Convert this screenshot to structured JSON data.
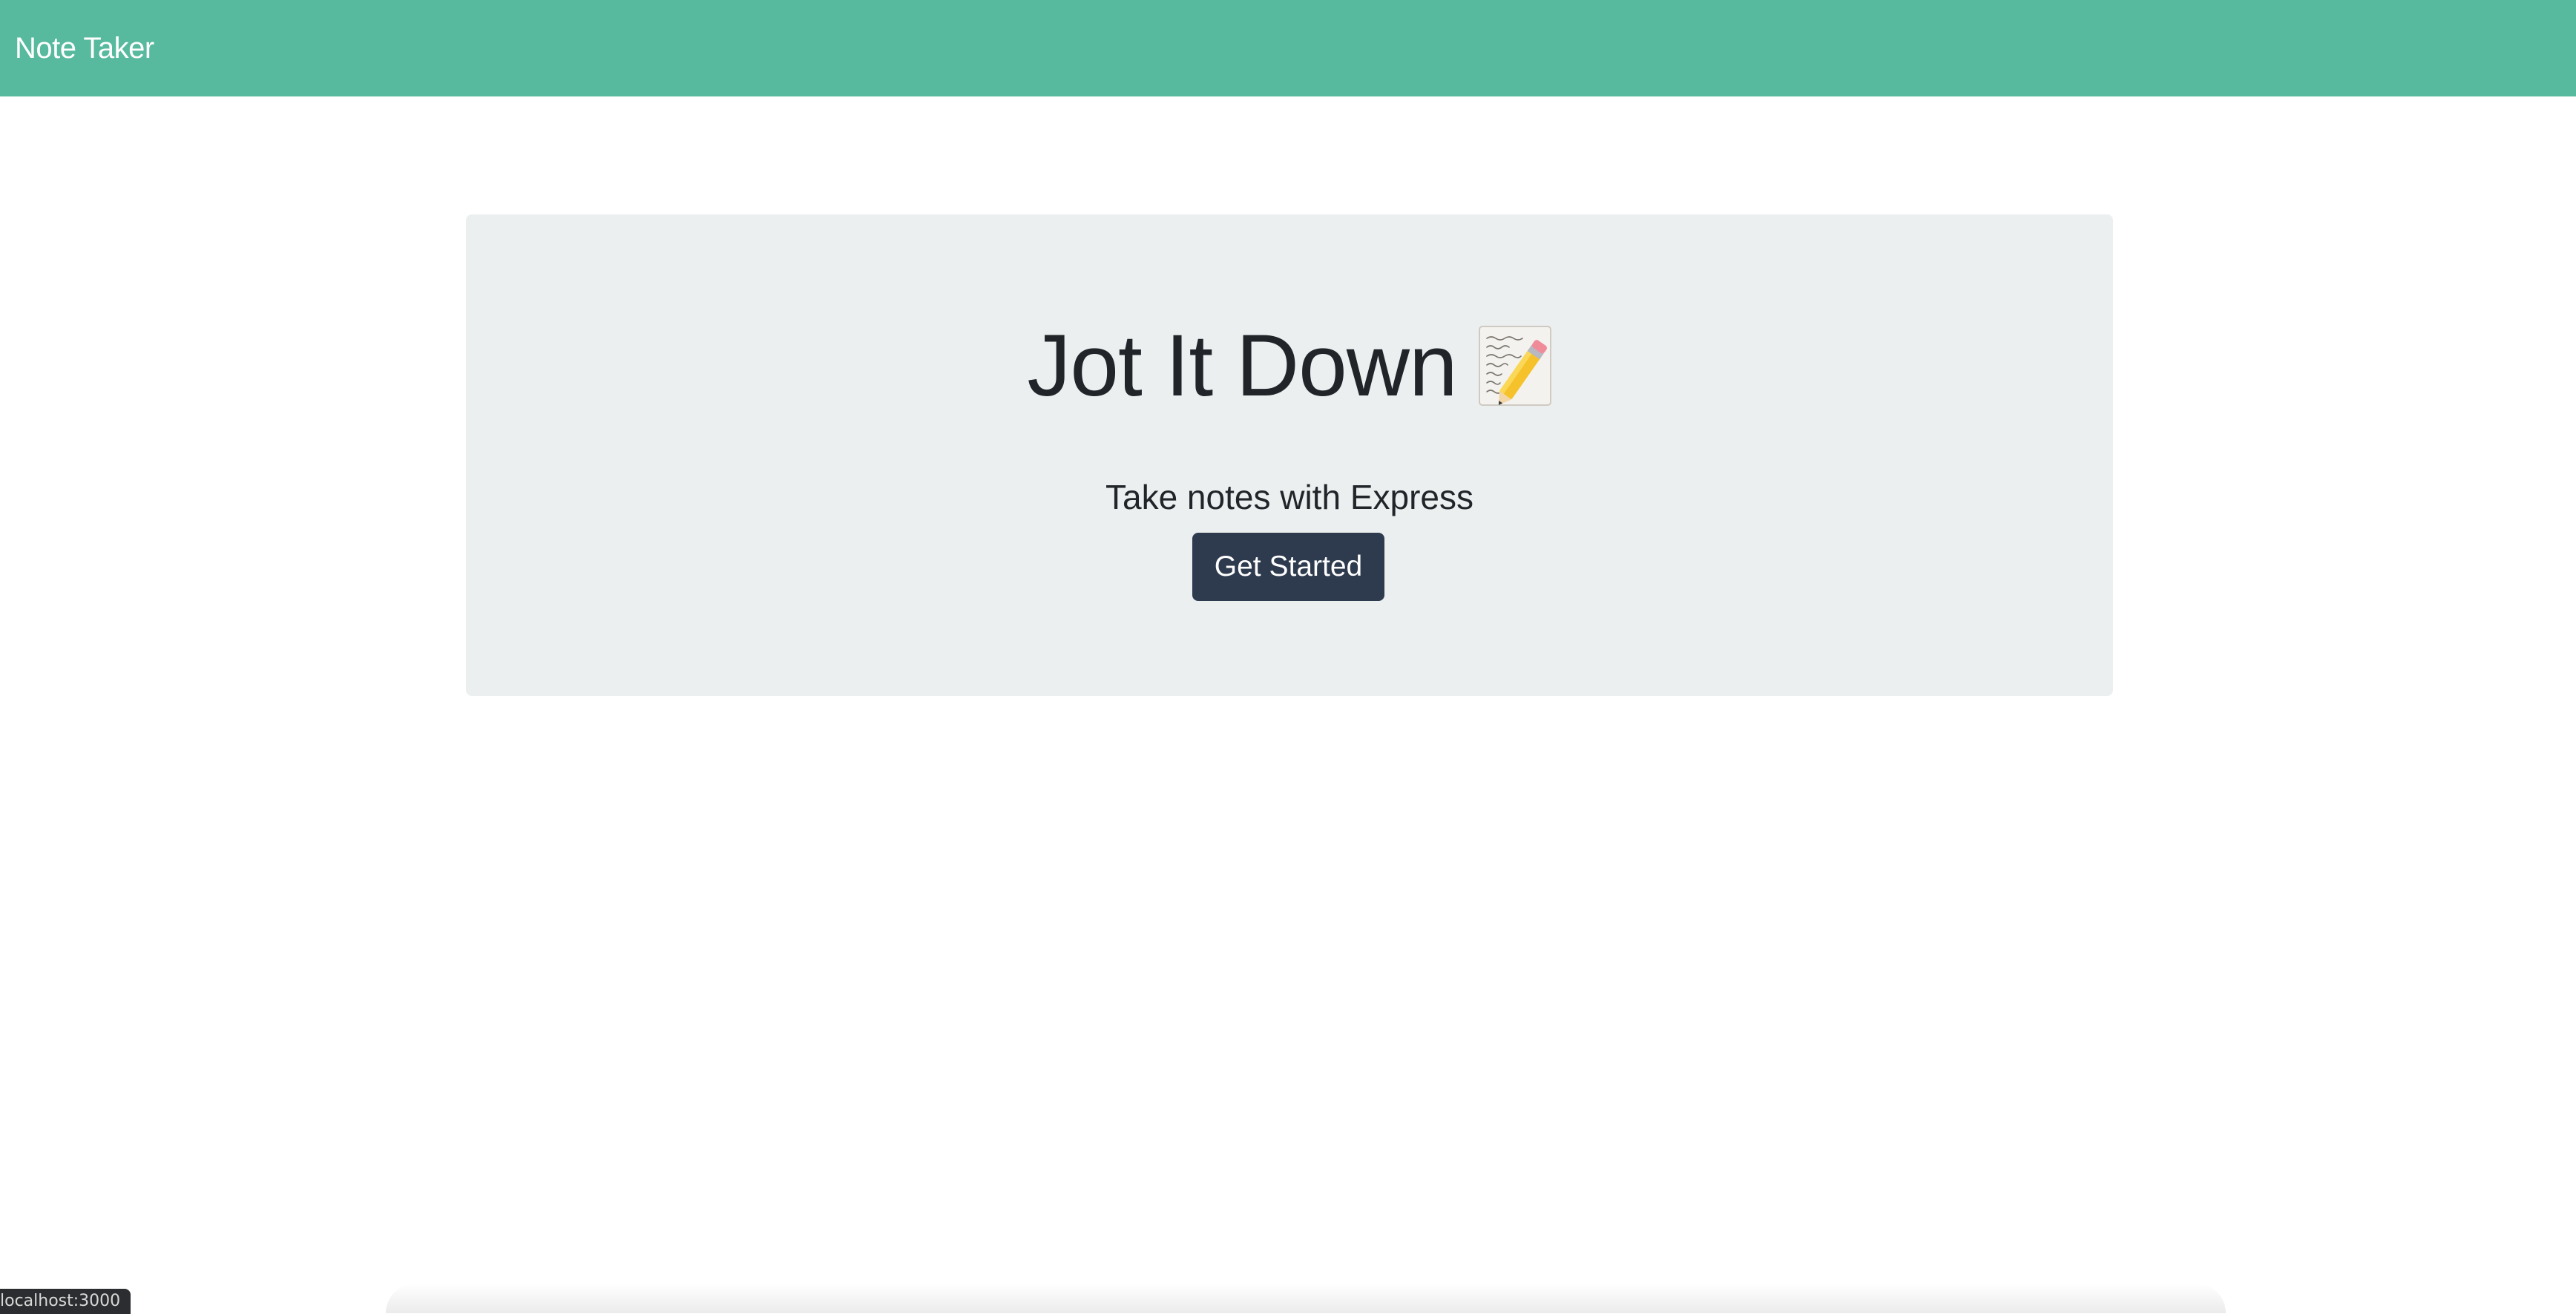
{
  "navbar": {
    "brand": "Note Taker",
    "color": "#57b99d"
  },
  "hero": {
    "title": "Jot It Down",
    "title_icon": "memo-icon",
    "subtitle": "Take notes with Express",
    "cta_label": "Get Started",
    "background": "#eceff0",
    "cta_color": "#2e3a4e"
  },
  "status_bar": {
    "url": "localhost:3000"
  }
}
